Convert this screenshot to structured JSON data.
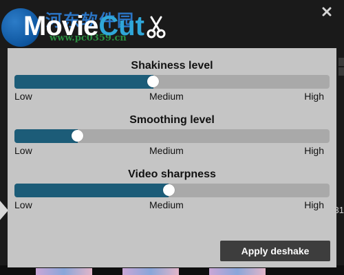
{
  "header": {
    "logo_movie": "Movie",
    "logo_cut": "Cut",
    "watermark_text": "河东软件园",
    "watermark_url": "www.pc0359.cn"
  },
  "background": {
    "right_digit": "31"
  },
  "sliders": [
    {
      "title": "Shakiness level",
      "low": "Low",
      "medium": "Medium",
      "high": "High",
      "level": 0.44
    },
    {
      "title": "Smoothing level",
      "low": "Low",
      "medium": "Medium",
      "high": "High",
      "level": 0.2
    },
    {
      "title": "Video sharpness",
      "low": "Low",
      "medium": "Medium",
      "high": "High",
      "level": 0.49
    }
  ],
  "apply_button": "Apply deshake",
  "colors": {
    "panel": "#c5c5c5",
    "track": "#a9a9a9",
    "fill": "#1c5c78",
    "button": "#3d3d3d",
    "logo_accent": "#2fa6d8"
  }
}
